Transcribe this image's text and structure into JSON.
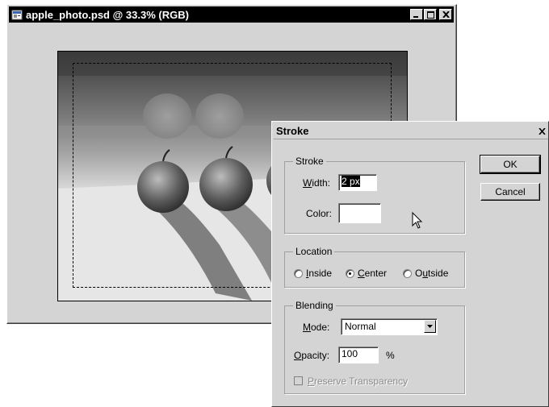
{
  "document_window": {
    "title": "apple_photo.psd @ 33.3% (RGB)",
    "icon": "photoshop-document-icon",
    "buttons": [
      "minimize-icon",
      "maximize-icon",
      "close-icon"
    ]
  },
  "dialog": {
    "title": "Stroke",
    "stroke_group": {
      "legend": "Stroke",
      "width_label_u": "W",
      "width_label_rest": "idth:",
      "width_value": "2 px",
      "color_label": "Color:",
      "color_value": "#ffffff"
    },
    "location_group": {
      "legend": "Location",
      "options": [
        {
          "u": "I",
          "rest": "nside",
          "selected": false
        },
        {
          "u": "C",
          "rest": "enter",
          "selected": true
        },
        {
          "pre": "O",
          "u": "u",
          "rest": "tside",
          "selected": false
        }
      ]
    },
    "blending_group": {
      "legend": "Blending",
      "mode_label_u": "M",
      "mode_label_rest": "ode:",
      "mode_value": "Normal",
      "opacity_label_u": "O",
      "opacity_label_rest": "pacity:",
      "opacity_value": "100",
      "opacity_unit": "%",
      "preserve_u": "P",
      "preserve_rest": "reserve Transparency",
      "preserve_checked": false,
      "preserve_enabled": false
    },
    "ok_label": "OK",
    "cancel_label": "Cancel"
  }
}
